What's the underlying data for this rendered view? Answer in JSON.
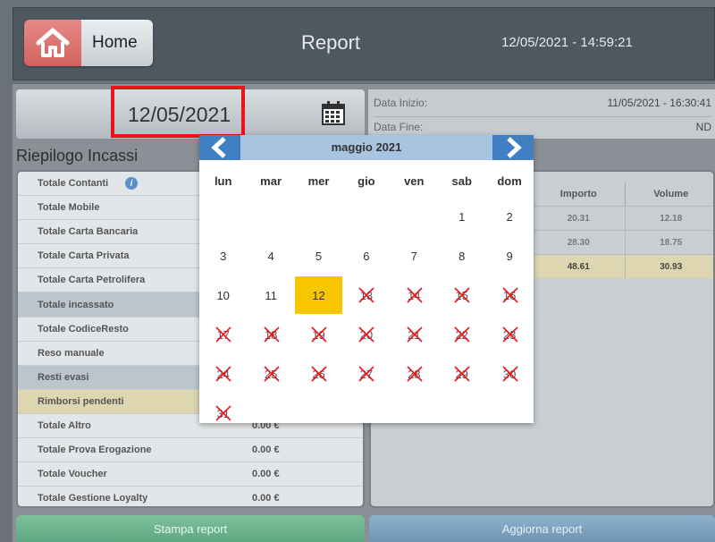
{
  "header": {
    "home_label": "Home",
    "title": "Report",
    "datetime": "12/05/2021 - 14:59:21"
  },
  "date_selector": {
    "value": "12/05/2021"
  },
  "info": {
    "start_label": "Data Inizio:",
    "start_value": "11/05/2021 - 16:30:41",
    "end_label": "Data Fine:",
    "end_value": "ND"
  },
  "summary_title": "Riepilogo Incassi",
  "left_rows": [
    {
      "label": "Totale Contanti",
      "amount": ""
    },
    {
      "label": "Totale Mobile",
      "amount": ""
    },
    {
      "label": "Totale Carta Bancaria",
      "amount": ""
    },
    {
      "label": "Totale Carta Privata",
      "amount": ""
    },
    {
      "label": "Totale Carta Petrolifera",
      "amount": ""
    },
    {
      "label": "Totale incassato",
      "amount": ""
    },
    {
      "label": "Totale CodiceResto",
      "amount": ""
    },
    {
      "label": "Reso manuale",
      "amount": ""
    },
    {
      "label": "Resti evasi",
      "amount": ""
    },
    {
      "label": "Rimborsi pendenti",
      "amount": ""
    },
    {
      "label": "Totale Altro",
      "amount": "0.00 €"
    },
    {
      "label": "Totale Prova Erogazione",
      "amount": "0.00 €"
    },
    {
      "label": "Totale Voucher",
      "amount": "0.00 €"
    },
    {
      "label": "Totale Gestione Loyalty",
      "amount": "0.00 €"
    }
  ],
  "right_table": {
    "headers": [
      "Importo",
      "Volume"
    ],
    "rows": [
      [
        "20.31",
        "12.18"
      ],
      [
        "28.30",
        "18.75"
      ],
      [
        "48.61",
        "30.93"
      ]
    ]
  },
  "buttons": {
    "print": "Stampa report",
    "refresh": "Aggiorna report"
  },
  "calendar": {
    "month": "maggio 2021",
    "weekdays": [
      "lun",
      "mar",
      "mer",
      "gio",
      "ven",
      "sab",
      "dom"
    ],
    "days": [
      "1",
      "2",
      "3",
      "4",
      "5",
      "6",
      "7",
      "8",
      "9",
      "10",
      "11",
      "12",
      "13",
      "14",
      "15",
      "16",
      "17",
      "18",
      "19",
      "20",
      "21",
      "22",
      "23",
      "24",
      "25",
      "26",
      "27",
      "28",
      "29",
      "30",
      "31"
    ],
    "first_weekday_index": 5,
    "selected_day": "12",
    "disabled_from_day": "13",
    "colors": {
      "selected": "#f7c600",
      "disabled_mark": "#e8141a",
      "nav": "#3f7fc2"
    }
  }
}
